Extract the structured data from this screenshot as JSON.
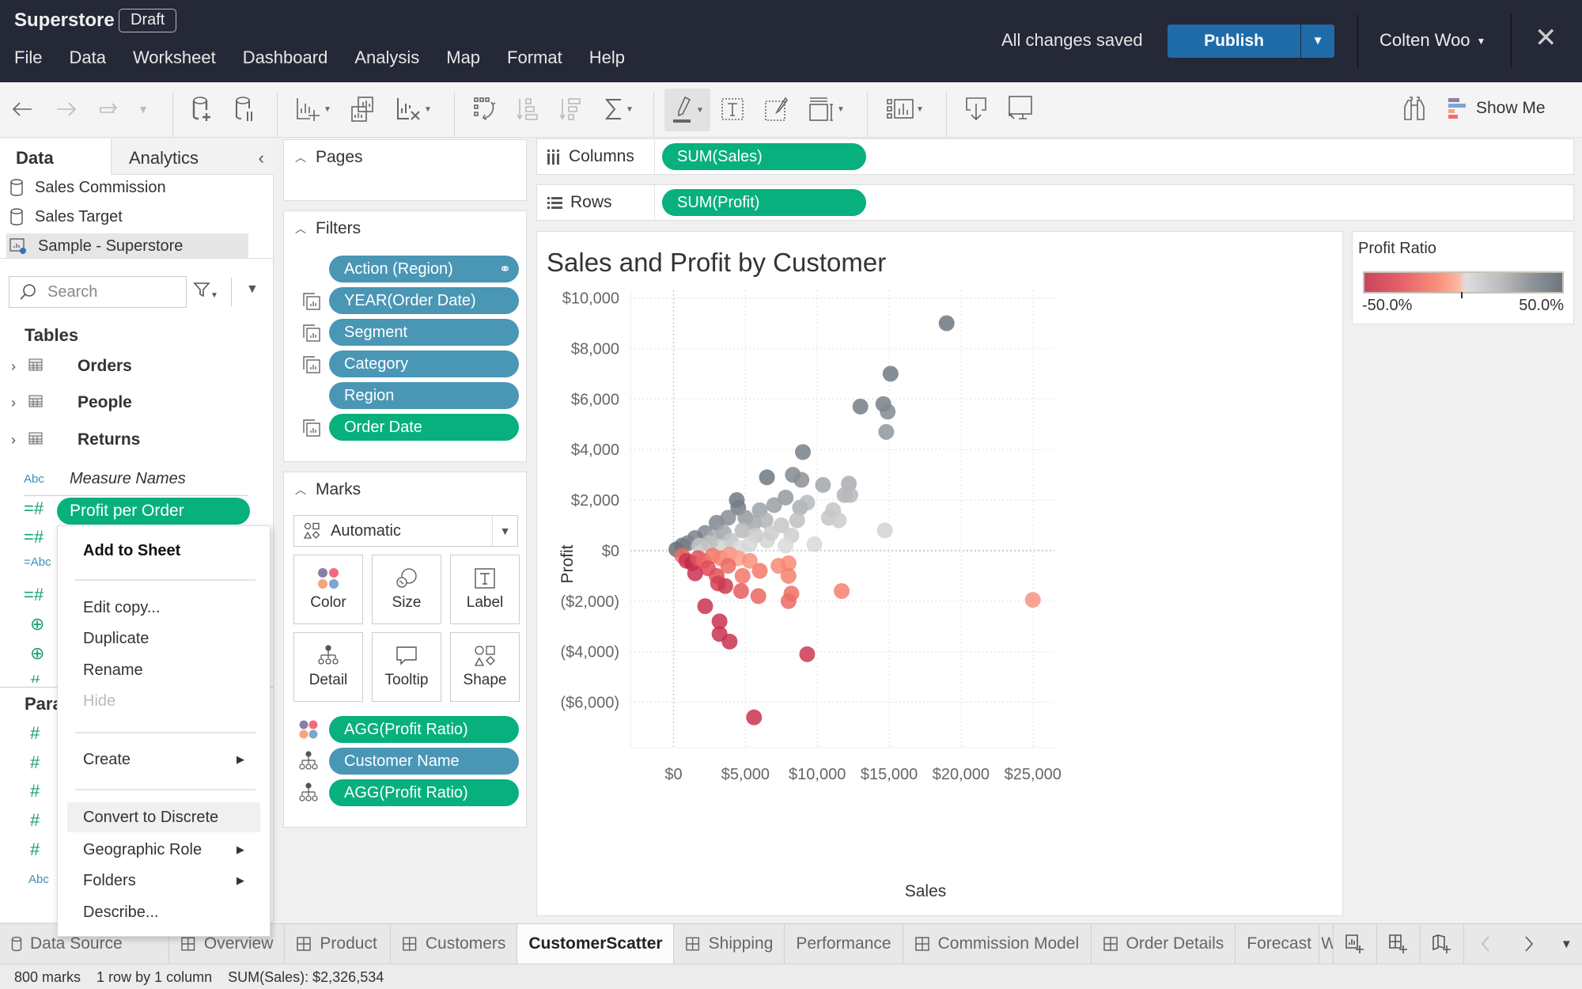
{
  "titlebar": {
    "app_name": "Superstore",
    "badge": "Draft",
    "menu": [
      "File",
      "Data",
      "Worksheet",
      "Dashboard",
      "Analysis",
      "Map",
      "Format",
      "Help"
    ],
    "save_status": "All changes saved",
    "publish_label": "Publish",
    "user_name": "Colten Woo",
    "close_icon": "close-icon"
  },
  "toolbar": {
    "items": [
      "undo",
      "redo",
      "replay-animation",
      "new-data-source",
      "pause-auto-updates",
      "new-worksheet",
      "duplicate-sheet",
      "clear-sheet",
      "swap-rows-columns",
      "sort-ascending",
      "sort-descending",
      "totals",
      "highlight",
      "show-mark-labels",
      "format-workbook",
      "fit",
      "show-cards",
      "download",
      "presentation-mode"
    ],
    "show_me_label": "Show Me",
    "accent_colors": {
      "purple": "#8c7fa6",
      "blue": "#7ca6cf",
      "orange": "#f4a57c",
      "red": "#f26b7a"
    }
  },
  "data_pane": {
    "tabs": {
      "data": "Data",
      "analytics": "Analytics"
    },
    "data_sources": [
      {
        "name": "Sales Commission",
        "icon": "database-icon"
      },
      {
        "name": "Sales Target",
        "icon": "database-icon"
      },
      {
        "name": "Sample - Superstore",
        "icon": "live-extract-icon",
        "selected": true
      }
    ],
    "search_placeholder": "Search",
    "tables_heading": "Tables",
    "tables": [
      "Orders",
      "People",
      "Returns"
    ],
    "measure_names": "Measure Names",
    "selected_field": "Profit per Order",
    "parameters_heading": "Para"
  },
  "context_menu": {
    "items": [
      {
        "label": "Add to Sheet",
        "bold": true
      },
      {
        "label": "Edit copy..."
      },
      {
        "label": "Duplicate"
      },
      {
        "label": "Rename"
      },
      {
        "label": "Hide",
        "disabled": true
      },
      {
        "label": "Create",
        "submenu": true
      },
      {
        "label": "Convert to Discrete",
        "hover": true
      },
      {
        "label": "Geographic Role",
        "submenu": true
      },
      {
        "label": "Folders",
        "submenu": true
      },
      {
        "label": "Describe..."
      }
    ]
  },
  "pages": {
    "title": "Pages"
  },
  "filters": {
    "title": "Filters",
    "pills": [
      {
        "label": "Action (Region)",
        "color": "blue",
        "icon": "linked-action-icon"
      },
      {
        "label": "YEAR(Order Date)",
        "color": "blue",
        "applied": true
      },
      {
        "label": "Segment",
        "color": "blue",
        "applied": true
      },
      {
        "label": "Category",
        "color": "blue",
        "applied": true
      },
      {
        "label": "Region",
        "color": "blue"
      },
      {
        "label": "Order Date",
        "color": "green",
        "applied": true
      }
    ]
  },
  "marks": {
    "title": "Marks",
    "mark_type": "Automatic",
    "buttons": [
      "Color",
      "Size",
      "Label",
      "Detail",
      "Tooltip",
      "Shape"
    ],
    "pills": [
      {
        "label": "AGG(Profit Ratio)",
        "color": "green",
        "encoding": "color"
      },
      {
        "label": "Customer Name",
        "color": "blue",
        "encoding": "detail"
      },
      {
        "label": "AGG(Profit Ratio)",
        "color": "green",
        "encoding": "detail"
      }
    ]
  },
  "shelves": {
    "columns_label": "Columns",
    "columns_pill": "SUM(Sales)",
    "rows_label": "Rows",
    "rows_pill": "SUM(Profit)"
  },
  "legend": {
    "title": "Profit Ratio",
    "min_label": "-50.0%",
    "max_label": "50.0%",
    "colors": {
      "negative": "#c8455f",
      "mid_negative": "#f9937b",
      "neutral": "#dedede",
      "positive": "#6d7780"
    }
  },
  "chart_data": {
    "type": "scatter",
    "title": "Sales and Profit by Customer",
    "xlabel": "Sales",
    "ylabel": "Profit",
    "xlim": [
      -3000,
      26500
    ],
    "ylim": [
      -7800,
      10300
    ],
    "x_ticks": [
      0,
      5000,
      10000,
      15000,
      20000,
      25000
    ],
    "x_tick_labels": [
      "$0",
      "$5,000",
      "$10,000",
      "$15,000",
      "$20,000",
      "$25,000"
    ],
    "y_ticks": [
      10000,
      8000,
      6000,
      4000,
      2000,
      0,
      -2000,
      -4000,
      -6000
    ],
    "y_tick_labels": [
      "$10,000",
      "$8,000",
      "$6,000",
      "$4,000",
      "$2,000",
      "$0",
      "($2,000)",
      "($4,000)",
      "($6,000)"
    ],
    "grid": true,
    "color_field": "Profit Ratio",
    "color_range": [
      -0.5,
      0.5
    ],
    "points": [
      {
        "x": 19000,
        "y": 9000,
        "ratio": 0.48
      },
      {
        "x": 15100,
        "y": 7000,
        "ratio": 0.46
      },
      {
        "x": 13000,
        "y": 5700,
        "ratio": 0.44
      },
      {
        "x": 14600,
        "y": 5800,
        "ratio": 0.43
      },
      {
        "x": 14900,
        "y": 5500,
        "ratio": 0.38
      },
      {
        "x": 14800,
        "y": 4700,
        "ratio": 0.32
      },
      {
        "x": 9000,
        "y": 3900,
        "ratio": 0.43
      },
      {
        "x": 6500,
        "y": 2900,
        "ratio": 0.47
      },
      {
        "x": 8300,
        "y": 3000,
        "ratio": 0.38
      },
      {
        "x": 8900,
        "y": 2800,
        "ratio": 0.35
      },
      {
        "x": 10400,
        "y": 2600,
        "ratio": 0.25
      },
      {
        "x": 12200,
        "y": 2650,
        "ratio": 0.22
      },
      {
        "x": 11900,
        "y": 2200,
        "ratio": 0.2
      },
      {
        "x": 12300,
        "y": 2200,
        "ratio": 0.18
      },
      {
        "x": 11100,
        "y": 1600,
        "ratio": 0.13
      },
      {
        "x": 10800,
        "y": 1300,
        "ratio": 0.12
      },
      {
        "x": 11500,
        "y": 1200,
        "ratio": 0.09
      },
      {
        "x": 14700,
        "y": 800,
        "ratio": 0.05
      },
      {
        "x": 9800,
        "y": 250,
        "ratio": 0.03
      },
      {
        "x": 4400,
        "y": 2000,
        "ratio": 0.46
      },
      {
        "x": 4500,
        "y": 1700,
        "ratio": 0.44
      },
      {
        "x": 7800,
        "y": 2100,
        "ratio": 0.3
      },
      {
        "x": 7000,
        "y": 1800,
        "ratio": 0.28
      },
      {
        "x": 6000,
        "y": 1600,
        "ratio": 0.27
      },
      {
        "x": 8800,
        "y": 1700,
        "ratio": 0.22
      },
      {
        "x": 9300,
        "y": 1900,
        "ratio": 0.18
      },
      {
        "x": 8600,
        "y": 1200,
        "ratio": 0.15
      },
      {
        "x": 7500,
        "y": 1000,
        "ratio": 0.12
      },
      {
        "x": 8200,
        "y": 600,
        "ratio": 0.08
      },
      {
        "x": 6500,
        "y": 400,
        "ratio": 0.05
      },
      {
        "x": 7800,
        "y": 200,
        "ratio": 0.02
      },
      {
        "x": 3000,
        "y": 1100,
        "ratio": 0.4
      },
      {
        "x": 3800,
        "y": 1300,
        "ratio": 0.36
      },
      {
        "x": 5000,
        "y": 1300,
        "ratio": 0.3
      },
      {
        "x": 5600,
        "y": 1100,
        "ratio": 0.24
      },
      {
        "x": 6400,
        "y": 1200,
        "ratio": 0.2
      },
      {
        "x": 4800,
        "y": 800,
        "ratio": 0.18
      },
      {
        "x": 3500,
        "y": 700,
        "ratio": 0.25
      },
      {
        "x": 2200,
        "y": 700,
        "ratio": 0.38
      },
      {
        "x": 2800,
        "y": 500,
        "ratio": 0.22
      },
      {
        "x": 4000,
        "y": 400,
        "ratio": 0.12
      },
      {
        "x": 5700,
        "y": 600,
        "ratio": 0.1
      },
      {
        "x": 6800,
        "y": 700,
        "ratio": 0.09
      },
      {
        "x": 1500,
        "y": 500,
        "ratio": 0.42
      },
      {
        "x": 1000,
        "y": 300,
        "ratio": 0.4
      },
      {
        "x": 600,
        "y": 200,
        "ratio": 0.45
      },
      {
        "x": 200,
        "y": 50,
        "ratio": 0.5
      },
      {
        "x": 1800,
        "y": 200,
        "ratio": 0.12
      },
      {
        "x": 3200,
        "y": 150,
        "ratio": 0.05
      },
      {
        "x": 4600,
        "y": 100,
        "ratio": 0.02
      },
      {
        "x": 5300,
        "y": 250,
        "ratio": 0.04
      },
      {
        "x": 2500,
        "y": 300,
        "ratio": 0.15
      },
      {
        "x": 600,
        "y": -200,
        "ratio": -0.2
      },
      {
        "x": 900,
        "y": -400,
        "ratio": -0.45
      },
      {
        "x": 1300,
        "y": -500,
        "ratio": -0.5
      },
      {
        "x": 1700,
        "y": -300,
        "ratio": -0.3
      },
      {
        "x": 2100,
        "y": -400,
        "ratio": -0.22
      },
      {
        "x": 2700,
        "y": -200,
        "ratio": -0.15
      },
      {
        "x": 3300,
        "y": -300,
        "ratio": -0.12
      },
      {
        "x": 3900,
        "y": -150,
        "ratio": -0.08
      },
      {
        "x": 4500,
        "y": -300,
        "ratio": -0.06
      },
      {
        "x": 5300,
        "y": -400,
        "ratio": -0.09
      },
      {
        "x": 2400,
        "y": -700,
        "ratio": -0.32
      },
      {
        "x": 1500,
        "y": -900,
        "ratio": -0.45
      },
      {
        "x": 3000,
        "y": -1000,
        "ratio": -0.3
      },
      {
        "x": 3800,
        "y": -600,
        "ratio": -0.2
      },
      {
        "x": 4800,
        "y": -1000,
        "ratio": -0.15
      },
      {
        "x": 6000,
        "y": -800,
        "ratio": -0.15
      },
      {
        "x": 7300,
        "y": -600,
        "ratio": -0.1
      },
      {
        "x": 8000,
        "y": -500,
        "ratio": -0.1
      },
      {
        "x": 8000,
        "y": -1000,
        "ratio": -0.12
      },
      {
        "x": 3100,
        "y": -1300,
        "ratio": -0.38
      },
      {
        "x": 3600,
        "y": -1400,
        "ratio": -0.42
      },
      {
        "x": 4700,
        "y": -1600,
        "ratio": -0.25
      },
      {
        "x": 5900,
        "y": -1800,
        "ratio": -0.22
      },
      {
        "x": 8200,
        "y": -1700,
        "ratio": -0.18
      },
      {
        "x": 8000,
        "y": -2000,
        "ratio": -0.2
      },
      {
        "x": 11700,
        "y": -1600,
        "ratio": -0.12
      },
      {
        "x": 25000,
        "y": -1950,
        "ratio": -0.08
      },
      {
        "x": 2200,
        "y": -2200,
        "ratio": -0.45
      },
      {
        "x": 3200,
        "y": -2800,
        "ratio": -0.45
      },
      {
        "x": 3200,
        "y": -3300,
        "ratio": -0.45
      },
      {
        "x": 3900,
        "y": -3600,
        "ratio": -0.45
      },
      {
        "x": 9300,
        "y": -4100,
        "ratio": -0.42
      },
      {
        "x": 5600,
        "y": -6600,
        "ratio": -0.45
      }
    ]
  },
  "sheet_tabs": [
    {
      "label": "Data Source",
      "icon": "database-icon"
    },
    {
      "label": "Overview",
      "icon": "dashboard-icon"
    },
    {
      "label": "Product",
      "icon": "dashboard-icon"
    },
    {
      "label": "Customers",
      "icon": "dashboard-icon"
    },
    {
      "label": "CustomerScatter",
      "active": true
    },
    {
      "label": "Shipping",
      "icon": "dashboard-icon"
    },
    {
      "label": "Performance"
    },
    {
      "label": "Commission Model",
      "icon": "dashboard-icon"
    },
    {
      "label": "Order Details",
      "icon": "dashboard-icon"
    },
    {
      "label": "Forecast"
    },
    {
      "label": "W"
    }
  ],
  "status_bar": {
    "marks": "800 marks",
    "dimensions": "1 row by 1 column",
    "sum": "SUM(Sales): $2,326,534"
  }
}
